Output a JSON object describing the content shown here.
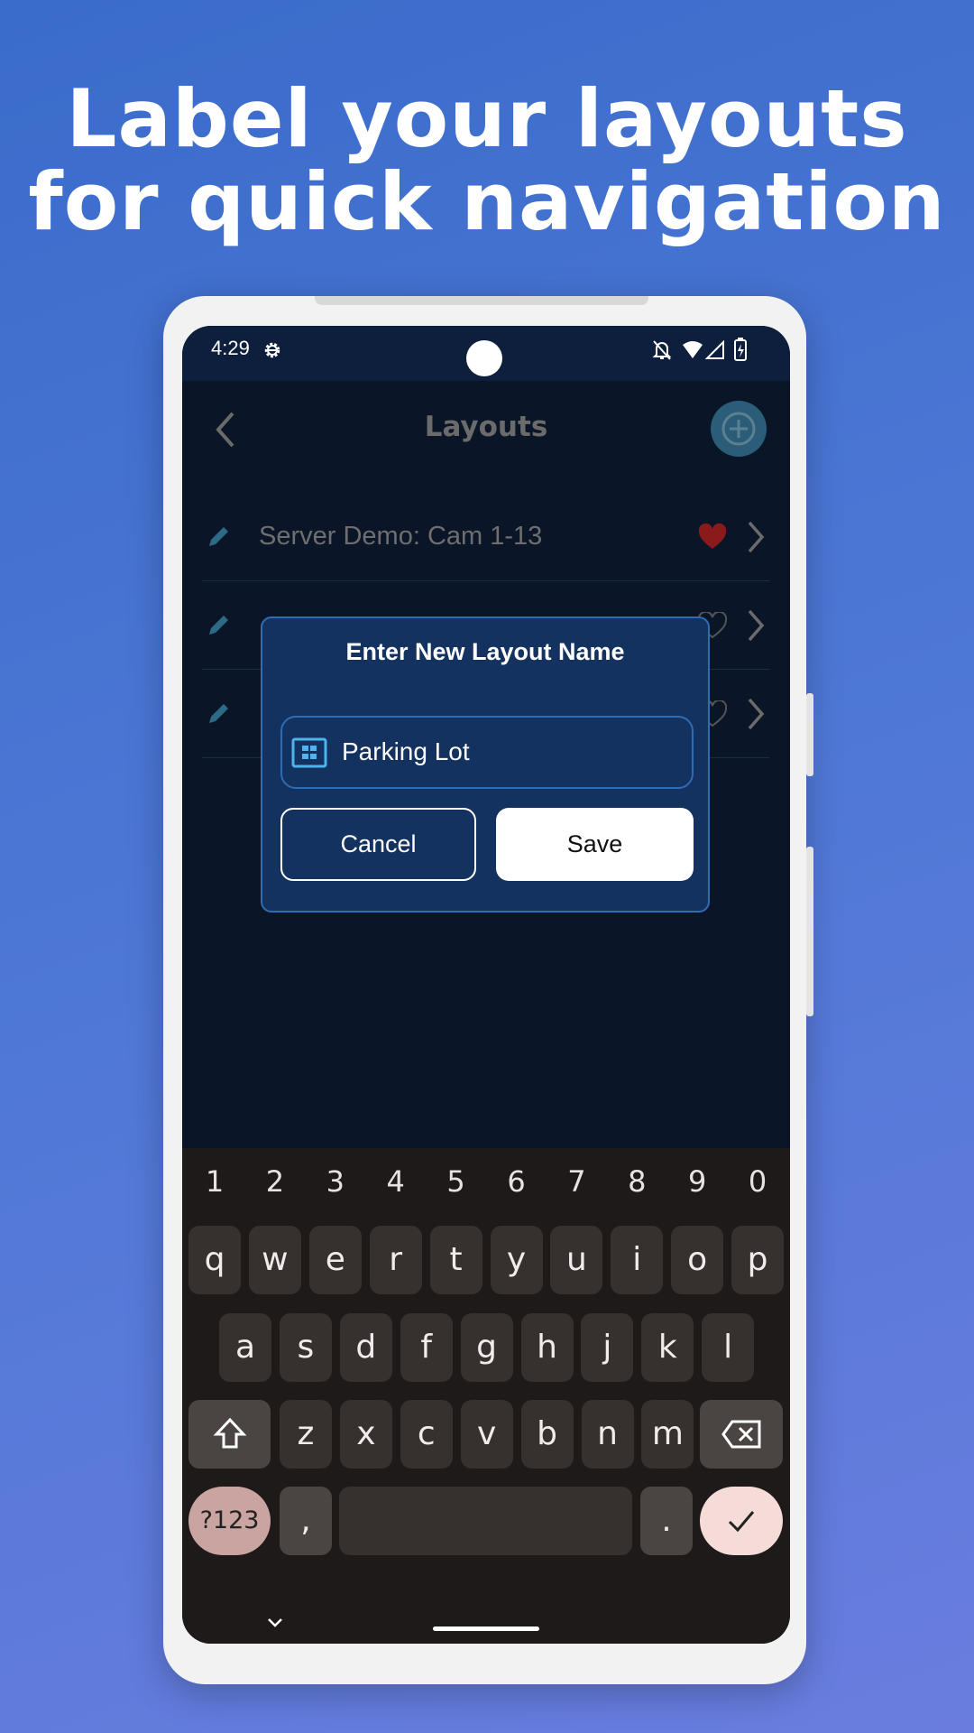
{
  "headline": {
    "line1": "Label your layouts",
    "line2": "for quick navigation"
  },
  "status_bar": {
    "time": "4:29",
    "left_icons": [
      "settings-gear-icon"
    ],
    "right_icons": [
      "notifications-off-icon",
      "wifi-icon",
      "signal-icon",
      "battery-charging-icon"
    ]
  },
  "header": {
    "title": "Layouts",
    "back_icon": "chevron-left-icon",
    "add_icon": "plus-circle-icon",
    "add_color": "#2b5d78"
  },
  "layouts": [
    {
      "label": "Server Demo: Cam 1-13",
      "favorite": true
    },
    {
      "label": "",
      "favorite": false
    },
    {
      "label": "",
      "favorite": false
    }
  ],
  "dialog": {
    "title": "Enter New Layout Name",
    "input_value": "Parking Lot",
    "input_icon": "grid-layout-icon",
    "cancel_label": "Cancel",
    "save_label": "Save"
  },
  "keyboard": {
    "numbers": [
      "1",
      "2",
      "3",
      "4",
      "5",
      "6",
      "7",
      "8",
      "9",
      "0"
    ],
    "row1": [
      "q",
      "w",
      "e",
      "r",
      "t",
      "y",
      "u",
      "i",
      "o",
      "p"
    ],
    "row2": [
      "a",
      "s",
      "d",
      "f",
      "g",
      "h",
      "j",
      "k",
      "l"
    ],
    "row3": [
      "z",
      "x",
      "c",
      "v",
      "b",
      "n",
      "m"
    ],
    "symbols_label": "?123",
    "comma": ",",
    "period": ".",
    "accent_color": "#f5dcd9",
    "symbols_color": "#c9a4a1"
  },
  "colors": {
    "dialog_bg": "#14325f",
    "dialog_border": "#2f6cb3",
    "favorite": "#8b1a1a",
    "app_bg": "#0a1628"
  }
}
